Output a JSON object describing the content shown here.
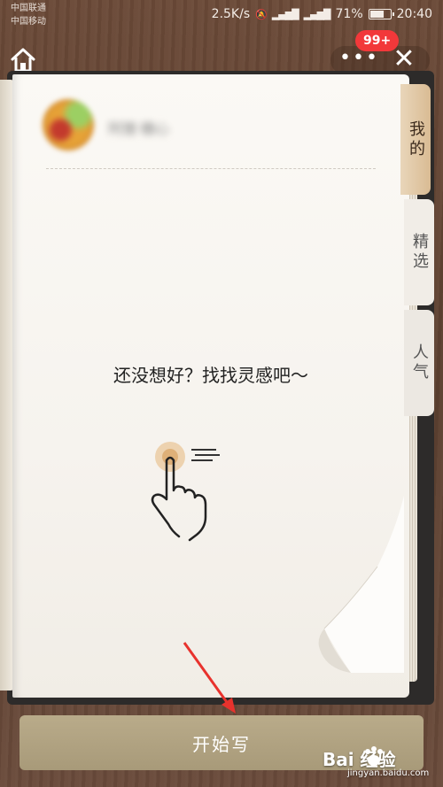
{
  "status_bar": {
    "carrier_1": "中国联通",
    "carrier_2": "中国移动",
    "speed": "2.5K/s",
    "battery": "71%",
    "battery_level": 0.71,
    "time": "20:40"
  },
  "header": {
    "more_label": "•••",
    "close_label": "✕",
    "badge": "99+"
  },
  "profile": {
    "name": "阿狸·糖心"
  },
  "tabs": [
    {
      "label": "我的",
      "active": true
    },
    {
      "label": "精选",
      "active": false
    },
    {
      "label": "人气",
      "active": false
    }
  ],
  "main": {
    "prompt": "还没想好？找找灵感吧～"
  },
  "footer": {
    "start_label": "开始写"
  },
  "watermark": {
    "text": "Bai  经验",
    "sub": "jingyan.baidu.com"
  },
  "colors": {
    "accent": "#b3a482",
    "tab_active": "#dcc19b",
    "badge": "#f2383a",
    "arrow": "#e8322d"
  }
}
